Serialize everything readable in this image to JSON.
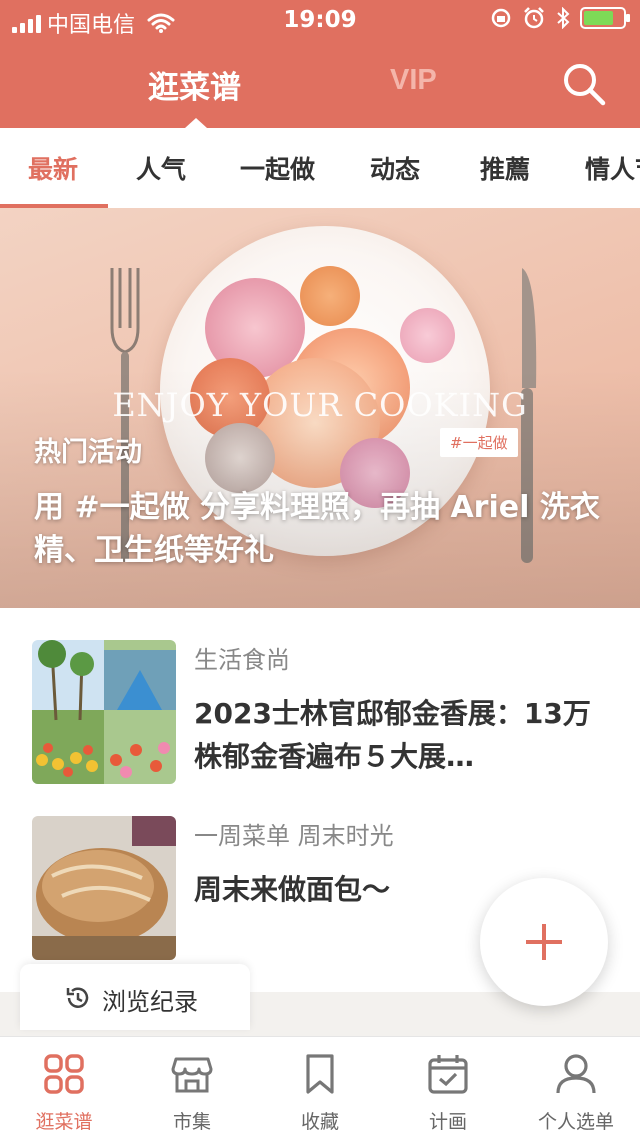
{
  "theme": {
    "accent": "#e07060"
  },
  "status_bar": {
    "carrier": "中国电信",
    "time": "19:09"
  },
  "header": {
    "main_tab": "逛菜谱",
    "vip_tab": "VIP",
    "search_icon": "search-icon"
  },
  "categories": [
    "最新",
    "人气",
    "一起做",
    "动态",
    "推薦",
    "情人节"
  ],
  "active_category": "最新",
  "banner": {
    "overlay_text": "ENJOY YOUR COOKING",
    "tag": "#一起做",
    "label": "热门活动",
    "title": "用 #一起做 分享料理照，再抽 Ariel 洗衣精、卫生纸等好礼"
  },
  "feed": [
    {
      "category": "生活食尚",
      "title": "2023士林官邸郁金香展：13万株郁金香遍布５大展…"
    },
    {
      "category": "一周菜单 周末时光",
      "title": "周末来做面包～"
    }
  ],
  "history": {
    "label": "浏览纪录"
  },
  "fab": {
    "icon": "plus-icon"
  },
  "tabbar": [
    {
      "label": "逛菜谱",
      "icon": "grid-icon"
    },
    {
      "label": "市集",
      "icon": "store-icon"
    },
    {
      "label": "收藏",
      "icon": "bookmark-icon"
    },
    {
      "label": "计画",
      "icon": "calendar-check-icon"
    },
    {
      "label": "个人选单",
      "icon": "user-icon"
    }
  ]
}
